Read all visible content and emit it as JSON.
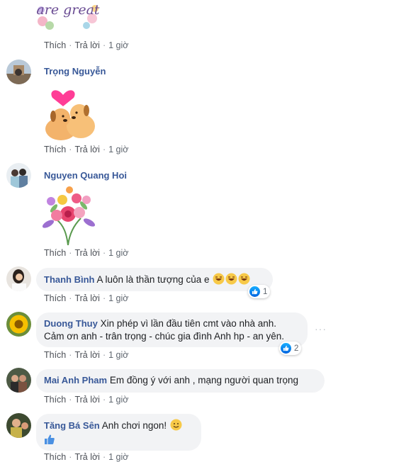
{
  "actions": {
    "like": "Thích",
    "reply": "Trả lời",
    "time": "1 giờ"
  },
  "comments": [
    {
      "name": ""
    },
    {
      "name": "Trọng Nguyễn"
    },
    {
      "name": "Nguyen Quang Hoi"
    },
    {
      "name": "Thanh Bình",
      "text": "A luôn là thần tượng của e",
      "reaction_count": "1"
    },
    {
      "name": "Duong Thuy",
      "text_line1": "Xin phép vì lần đầu tiên cmt vào nhà anh.",
      "text_line2": "Cảm ơn anh - trân trọng - chúc gia đình Anh hp - an yên.",
      "reaction_count": "2"
    },
    {
      "name": "Mai Anh Pham",
      "text": "Em đồng ý với anh , mạng người quan trọng"
    },
    {
      "name": "Tăng Bá Sên",
      "text": "Anh chơi ngon!"
    }
  ],
  "sticker_text": "are great",
  "more_icon": "···",
  "colors": {
    "name": "#385898",
    "like_blue": "#1877f2",
    "bubble": "#f2f3f5",
    "meta": "#606770"
  }
}
